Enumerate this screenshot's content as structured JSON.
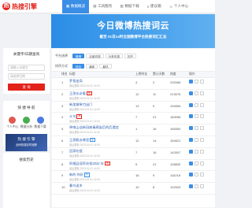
{
  "app": {
    "logo_char": "热",
    "title": "热搜引擎"
  },
  "nav": [
    {
      "icon": "▦",
      "label": "数据概览",
      "active": true
    },
    {
      "icon": "▤",
      "label": "工具服务",
      "active": false
    },
    {
      "icon": "▥",
      "label": "数据下载",
      "active": false
    },
    {
      "icon": "≡",
      "label": "建议箱",
      "active": false
    },
    {
      "icon": "☺",
      "label": "个人中心",
      "active": false
    }
  ],
  "banner": {
    "title": "今日微博热搜词云",
    "subtitle": "截至 01日14时全国微博平台热搜词汇汇总"
  },
  "search": {
    "title": "关键字/日期查询",
    "keyword_placeholder": "请输入关键字",
    "date_placeholder": "请选择日期",
    "button": "查 询"
  },
  "quick": {
    "title": "快 捷 导 航",
    "items": [
      {
        "label": "个人中心",
        "color": "red"
      },
      {
        "label": "数据分析",
        "color": "green"
      },
      {
        "label": "数据下载",
        "color": "blue"
      }
    ],
    "promo": {
      "line1": "热 搜 引 擎",
      "line2": "全网热搜实时追踪",
      "button": "立即使用"
    }
  },
  "history": {
    "title": "搜索历史"
  },
  "filters": {
    "row1_label": "平台选择",
    "row1": [
      {
        "label": "微博",
        "on": true
      },
      {
        "label": "百度热搜",
        "on": false
      },
      {
        "label": "头条热搜",
        "on": false
      },
      {
        "label": "知乎",
        "on": false
      }
    ],
    "row2_label": "排序方式",
    "row2": [
      {
        "label": "综合",
        "on": true
      },
      {
        "label": "最新",
        "on": false
      },
      {
        "label": "最热",
        "on": false
      }
    ]
  },
  "table": {
    "headers": [
      "排名",
      "标题",
      "上榜时长",
      "累计天数",
      "热度",
      "操作"
    ],
    "rows": [
      {
        "idx": "1",
        "title": "罗晋出局",
        "sub": "最后更新 2023-01-01 14:00",
        "tag": "",
        "cnt": "4",
        "day": "2",
        "hot": "232066"
      },
      {
        "idx": "2",
        "title": "王思长必看",
        "sub": "最后更新 2023-01-01 14:00",
        "tag": "热",
        "cnt": "12",
        "day": "11",
        "hot": "213076"
      },
      {
        "idx": "3",
        "title": "新加坡带刀出门",
        "sub": "最后更新 2023-01-01 14:00",
        "tag": "",
        "cnt": "13",
        "day": "9",
        "hot": "194506"
      },
      {
        "idx": "4",
        "title": "义乌",
        "sub": "最后更新 2023-01-01 14:00",
        "tag": "热",
        "cnt": "7",
        "day": "21",
        "hot": "183056"
      },
      {
        "idx": "5",
        "title": "钟南山谈新冠病毒感染后的后遗症",
        "sub": "最后更新 2023-01-01 14:00",
        "tag": "",
        "cnt": "1",
        "day": "16",
        "hot": "165300"
      },
      {
        "idx": "6",
        "title": "王思聪去哪里",
        "sub": "最后更新 2023-01-01 14:00",
        "tag": "新",
        "cnt": "12",
        "day": "14",
        "hot": "154521"
      },
      {
        "idx": "7",
        "title": "回家吃饭",
        "sub": "最后更新 2023-01-01 14:00",
        "tag": "",
        "cnt": "7",
        "day": "16",
        "hot": "143307"
      },
      {
        "idx": "8",
        "title": "阿根廷冠军庆祝2022 年",
        "sub": "最后更新 2023-01-01 14:00",
        "tag": "热",
        "cnt": "9",
        "day": "21",
        "hot": "128830"
      },
      {
        "idx": "9",
        "title": "新的 你好",
        "sub": "最后更新 2023-01-01 14:00",
        "tag": "新",
        "cnt": "16",
        "day": "9",
        "hot": "116218"
      },
      {
        "idx": "10",
        "title": "春节返乡",
        "sub": "最后更新 2023-01-01 14:00",
        "tag": "",
        "cnt": "10",
        "day": "8",
        "hot": "102943"
      }
    ]
  }
}
